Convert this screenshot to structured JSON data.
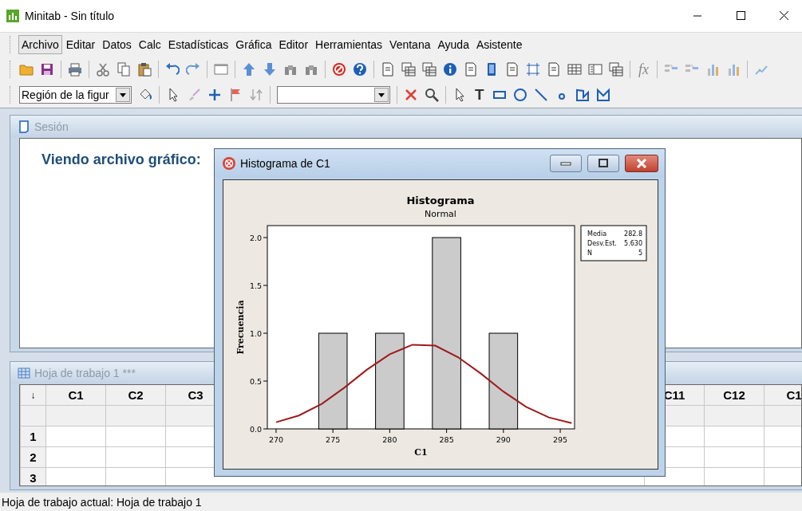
{
  "window": {
    "title": "Minitab - Sin título"
  },
  "menu": [
    {
      "label": "Archivo",
      "selected": true
    },
    {
      "label": "Editar",
      "selected": false
    },
    {
      "label": "Datos",
      "selected": false
    },
    {
      "label": "Calc",
      "selected": false
    },
    {
      "label": "Estadísticas",
      "selected": false
    },
    {
      "label": "Gráfica",
      "selected": false
    },
    {
      "label": "Editor",
      "selected": false
    },
    {
      "label": "Herramientas",
      "selected": false
    },
    {
      "label": "Ventana",
      "selected": false
    },
    {
      "label": "Ayuda",
      "selected": false
    },
    {
      "label": "Asistente",
      "selected": false
    }
  ],
  "toolbars": {
    "function_button": "fx",
    "region_dropdown": {
      "value": "Región de la figur"
    },
    "text_tool": "T"
  },
  "session": {
    "title": "Sesión",
    "text": "Viendo archivo gráfico:"
  },
  "worksheet": {
    "title": "Hoja de trabajo 1 ***",
    "corner": "↓",
    "columns_left": [
      "C1",
      "C2",
      "C3"
    ],
    "columns_right": [
      "C11",
      "C12",
      "C1"
    ],
    "rows": [
      "1",
      "2",
      "3"
    ]
  },
  "graph_window": {
    "title": "Histograma de C1",
    "heading": "Histograma",
    "subtitle": "Normal",
    "stats": [
      {
        "label": "Media",
        "value": "282.8"
      },
      {
        "label": "Desv.Est.",
        "value": "5.630"
      },
      {
        "label": "N",
        "value": "5"
      }
    ],
    "chart_data": {
      "type": "bar",
      "xlabel": "C1",
      "ylabel": "Frecuencia",
      "x": [
        275,
        280,
        285,
        290
      ],
      "xlim": [
        269.23,
        296.26
      ],
      "ylim": [
        0,
        2.125
      ],
      "xticks": [
        270,
        275,
        280,
        285,
        290,
        295
      ],
      "yticks": [
        {
          "value": 0,
          "label": "0.0"
        },
        {
          "value": 0.5,
          "label": "0.5"
        },
        {
          "value": 1,
          "label": "1.0"
        },
        {
          "value": 1.5,
          "label": "1.5"
        },
        {
          "value": 2,
          "label": "2.0"
        }
      ],
      "series": [
        {
          "color": "#cbcbcb",
          "values": [
            1,
            1,
            2,
            1
          ]
        },
        {
          "type": "line",
          "color": "#9e1b1b",
          "x": [
            270,
            272,
            274,
            276,
            278,
            280,
            282,
            284,
            286,
            288,
            290,
            292,
            294,
            296
          ],
          "values": [
            0.07,
            0.14,
            0.26,
            0.43,
            0.62,
            0.78,
            0.88,
            0.87,
            0.75,
            0.58,
            0.39,
            0.23,
            0.12,
            0.06
          ]
        }
      ]
    }
  },
  "status_bar": "Hoja de trabajo actual: Hoja de trabajo 1"
}
